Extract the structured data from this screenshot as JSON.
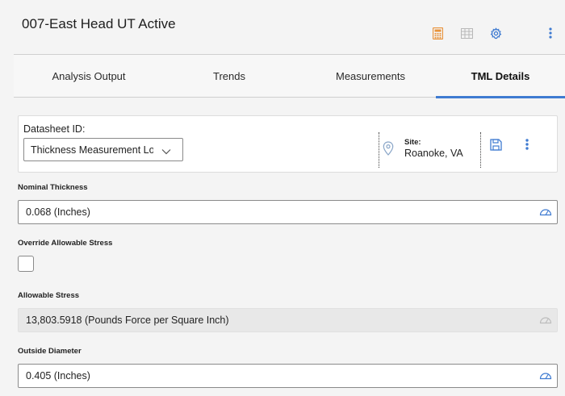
{
  "header": {
    "title": "007-East Head UT Active",
    "icons": [
      "calculator-icon",
      "table-grid-icon",
      "gear-icon",
      "kebab-menu-icon"
    ],
    "colors": {
      "calculator": "#e8923a",
      "grid": "#b8b8b8",
      "gear": "#3f7bd1",
      "kebab": "#3f7bd1"
    }
  },
  "tabs": [
    {
      "label": "Analysis Output",
      "active": false
    },
    {
      "label": "Trends",
      "active": false
    },
    {
      "label": "Measurements",
      "active": false
    },
    {
      "label": "TML Details",
      "active": true
    }
  ],
  "datasheet": {
    "label": "Datasheet ID:",
    "selected": "Thickness Measurement Location",
    "site_label": "Site:",
    "site_value": "Roanoke, VA"
  },
  "fields": {
    "nominal_thickness": {
      "label": "Nominal Thickness",
      "value": "0.068 (Inches)"
    },
    "override_allowable_stress": {
      "label": "Override Allowable Stress",
      "checked": false
    },
    "allowable_stress": {
      "label": "Allowable Stress",
      "value": "13,803.5918 (Pounds Force per Square Inch)"
    },
    "outside_diameter": {
      "label": "Outside Diameter",
      "value": "0.405 (Inches)"
    }
  },
  "accent_color": "#3f7bd1"
}
